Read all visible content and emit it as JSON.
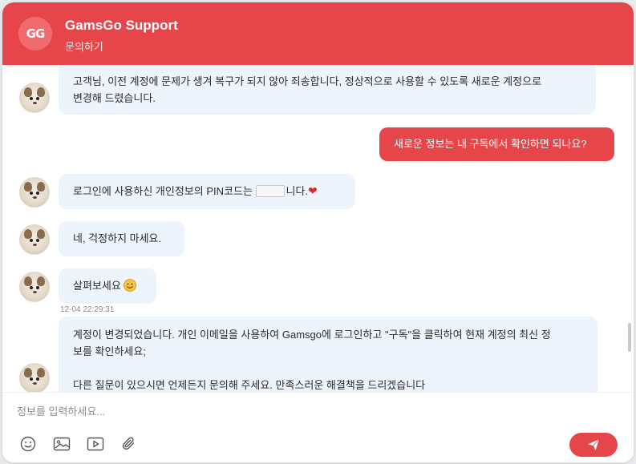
{
  "header": {
    "logo": "GG",
    "title": "GamsGo Support",
    "subtitle": "문의하기"
  },
  "messages": [
    {
      "from": "agent",
      "lines": [
        "고객님, 이전 계정에 문제가 생겨 복구가 되지 않아 죄송합니다, 정상적으로 사용할 수 있도록 새로운 계정으로",
        "변경해 드렸습니다."
      ]
    },
    {
      "from": "user",
      "text": "새로운 정보는 내 구독에서 확인하면 되나요?"
    },
    {
      "from": "agent",
      "text_before": "로그인에 사용하신 개인정보의 PIN코드는 ",
      "text_after": "니다."
    },
    {
      "from": "agent",
      "text": "네, 걱정하지 마세요."
    },
    {
      "from": "agent",
      "text": "살펴보세요",
      "timestamp": "12-04 22:29:31"
    },
    {
      "from": "agent",
      "lines": [
        "계정이 변경되었습니다. 개인 이메일을 사용하여 Gamsgo에 로그인하고 \"구독\"을 클릭하여 현재 계정의 최신 정",
        "보를 확인하세요;",
        "",
        "다른 질문이 있으시면 언제든지 문의해 주세요. 만족스러운 해결책을 드리겠습니다"
      ]
    }
  ],
  "composer": {
    "placeholder": "정보를 입력하세요..."
  },
  "colors": {
    "brand": "#e64549",
    "agent_bubble": "#eef4fc"
  },
  "icons": [
    "emoji-icon",
    "image-icon",
    "video-icon",
    "attachment-icon",
    "send-icon"
  ]
}
